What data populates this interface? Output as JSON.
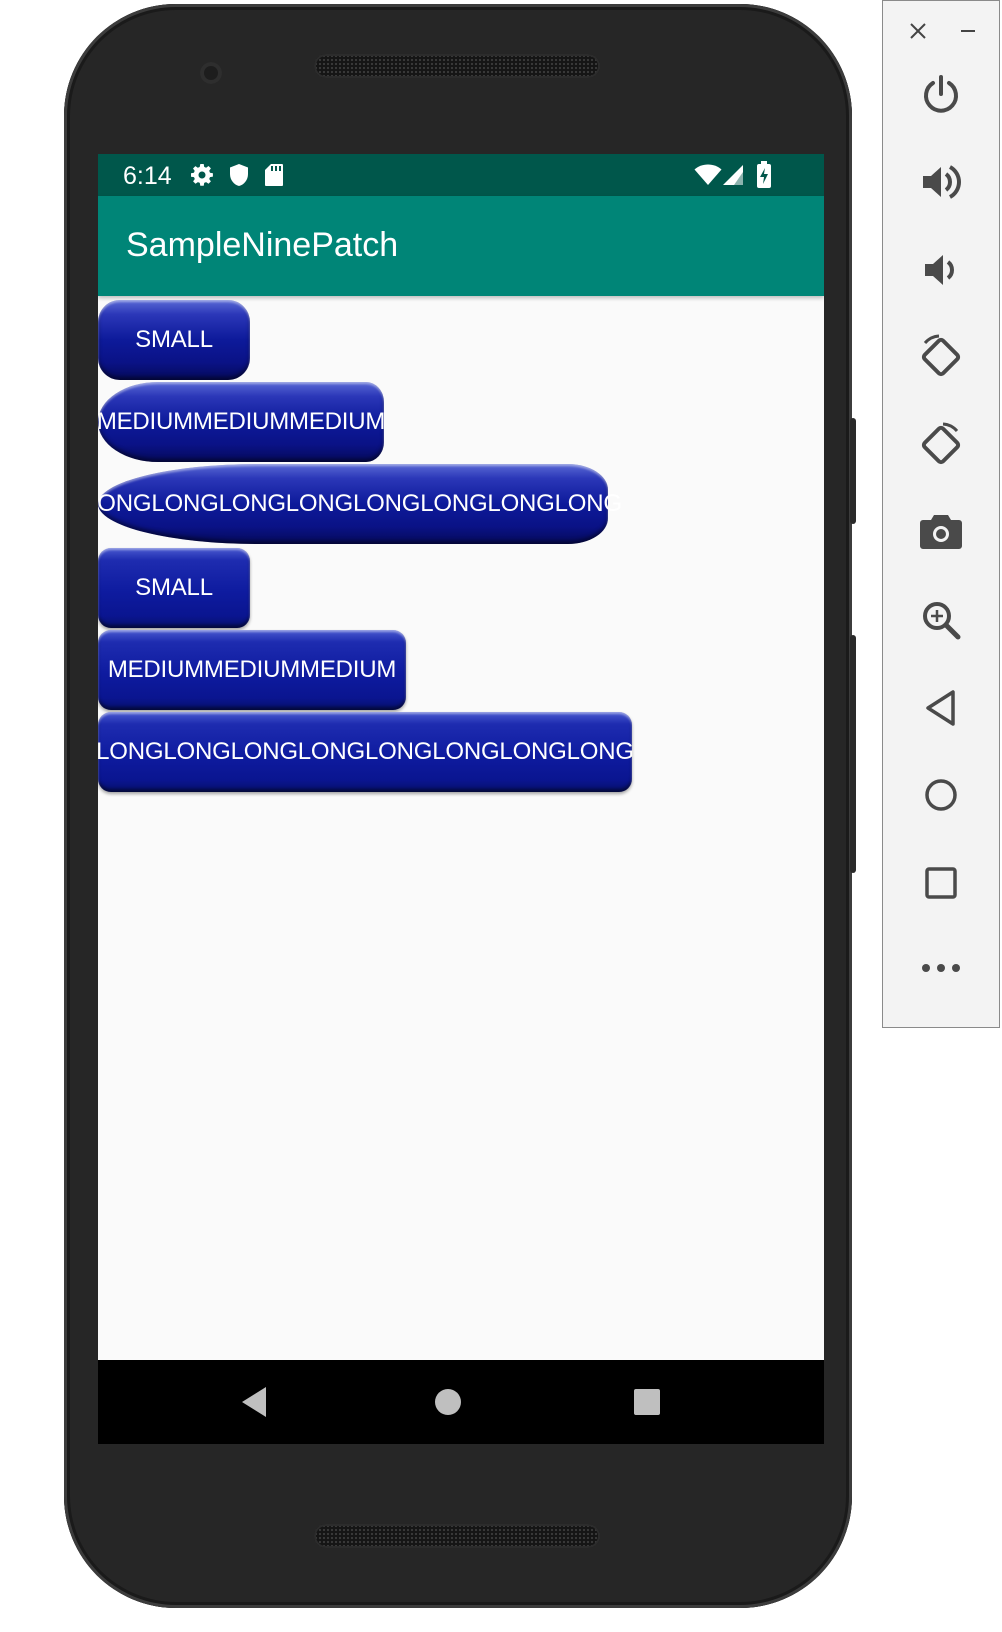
{
  "status_bar": {
    "time": "6:14",
    "icons": [
      "settings-gear-icon",
      "shield-icon",
      "sd-card-icon",
      "wifi-icon",
      "signal-icon",
      "battery-charging-icon"
    ]
  },
  "app_bar": {
    "title": "SampleNinePatch"
  },
  "buttons": [
    {
      "label": "SMALL",
      "style": "stretched-blob"
    },
    {
      "label": "MEDIUMMEDIUMMEDIUM",
      "style": "stretched-blob"
    },
    {
      "label": "LONGLONGLONGLONGLONGLONGLONGLONG",
      "style": "stretched-blob"
    },
    {
      "label": "SMALL",
      "style": "nine-patch"
    },
    {
      "label": "MEDIUMMEDIUMMEDIUM",
      "style": "nine-patch"
    },
    {
      "label": "LONGLONGLONGLONGLONGLONGLONGLONG",
      "style": "nine-patch"
    }
  ],
  "navigation_bar": {
    "items": [
      "back-icon",
      "home-icon",
      "recents-icon"
    ]
  },
  "emulator_panel": {
    "window_controls": [
      "close-icon",
      "minimize-icon"
    ],
    "tools": [
      "power-icon",
      "volume-up-icon",
      "volume-down-icon",
      "rotate-left-icon",
      "rotate-right-icon",
      "camera-icon",
      "zoom-icon",
      "back-icon",
      "home-icon",
      "overview-icon",
      "more-icon"
    ]
  },
  "colors": {
    "status_bar": "#00574b",
    "app_bar": "#008577",
    "button_blue": "#0d1a9a",
    "screen_background": "#fafafa"
  }
}
